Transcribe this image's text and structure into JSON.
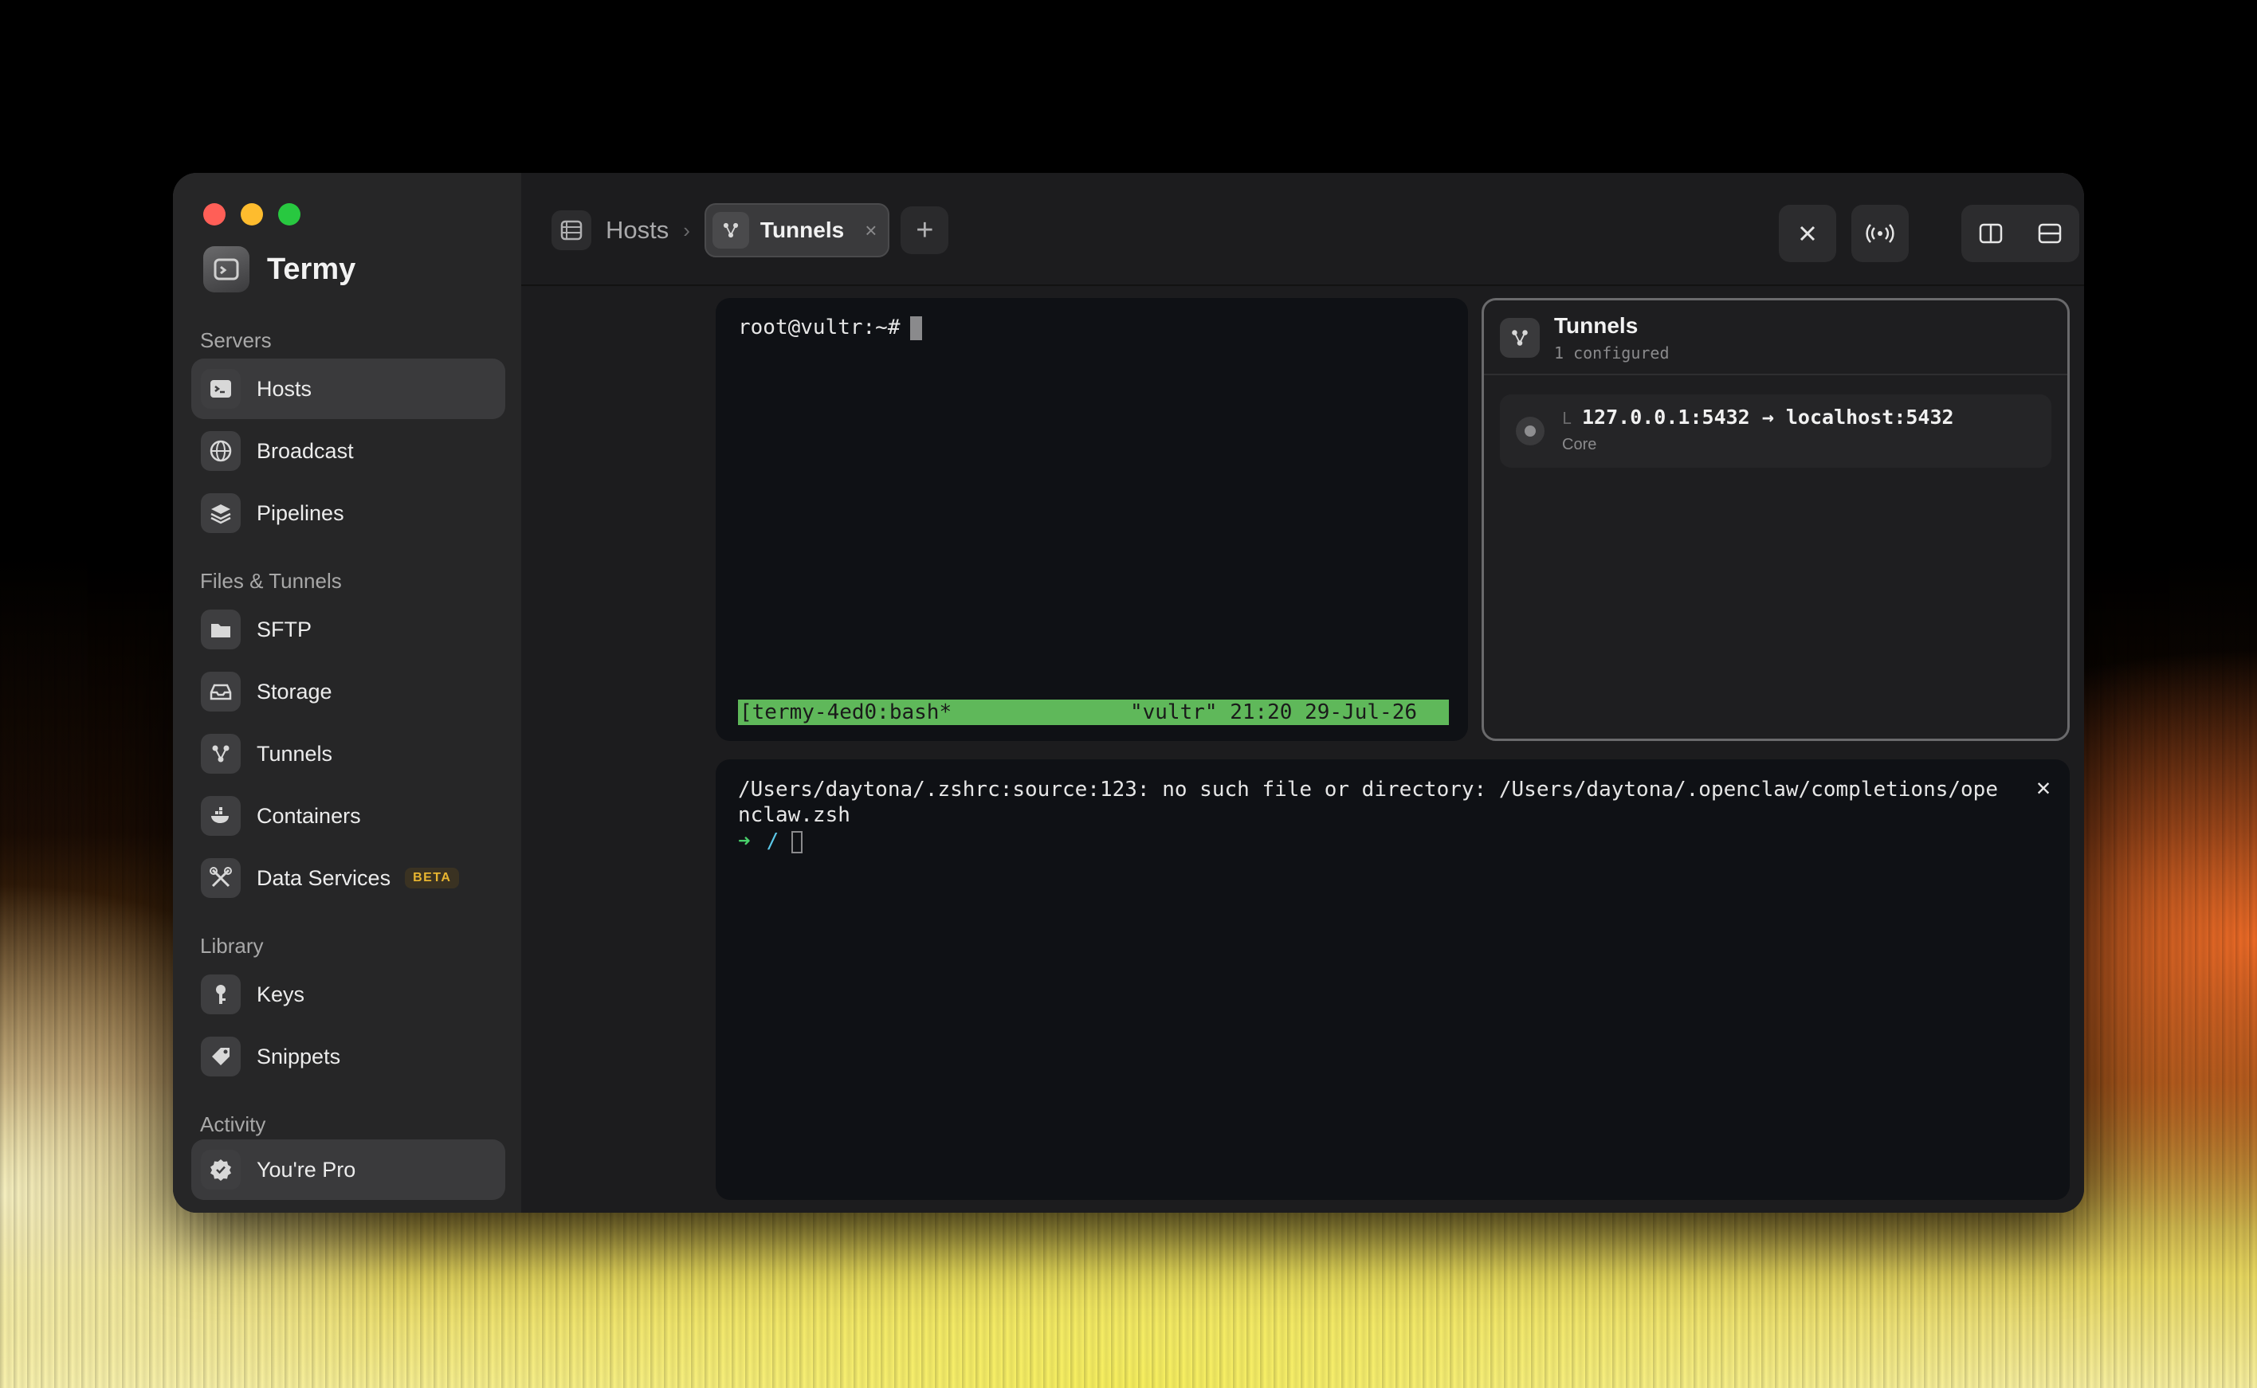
{
  "app": {
    "title": "Termy"
  },
  "sidebar": {
    "sections": [
      {
        "label": "Servers"
      },
      {
        "label": "Files & Tunnels"
      },
      {
        "label": "Library"
      },
      {
        "label": "Activity"
      }
    ],
    "items": [
      {
        "label": "Hosts",
        "icon": "terminal-icon"
      },
      {
        "label": "Broadcast",
        "icon": "globe-icon"
      },
      {
        "label": "Pipelines",
        "icon": "layers-icon"
      },
      {
        "label": "SFTP",
        "icon": "folder-icon"
      },
      {
        "label": "Storage",
        "icon": "tray-icon"
      },
      {
        "label": "Tunnels",
        "icon": "tunnel-nodes-icon"
      },
      {
        "label": "Containers",
        "icon": "whale-icon"
      },
      {
        "label": "Data Services",
        "icon": "tools-icon",
        "badge": "BETA"
      },
      {
        "label": "Keys",
        "icon": "key-icon"
      },
      {
        "label": "Snippets",
        "icon": "tag-icon"
      },
      {
        "label": "You're Pro",
        "icon": "verified-badge-icon"
      }
    ]
  },
  "topbar": {
    "breadcrumb": "Hosts",
    "tab": {
      "label": "Tunnels",
      "close": "×"
    },
    "add": "+"
  },
  "terminal1": {
    "prompt": "root@vultr:~#",
    "status_left": "[termy-4ed0:bash*",
    "status_right": "\"vultr\" 21:20 29-Jul-26"
  },
  "tunnels_panel": {
    "title": "Tunnels",
    "subtitle": "1 configured",
    "tunnels": [
      {
        "elbow": "L",
        "route": "127.0.0.1:5432 → localhost:5432",
        "group": "Core"
      }
    ]
  },
  "terminal2": {
    "error": "/Users/daytona/.zshrc:source:123: no such file or directory: /Users/daytona/.openclaw/completions/openclaw.zsh",
    "arrow": "➜",
    "path": "/",
    "close": "✕"
  },
  "colors": {
    "accent_green": "#5fb85a",
    "traffic_red": "#ff5f57",
    "traffic_yellow": "#febc2e",
    "traffic_green": "#28c840",
    "beta": "#e8b530"
  }
}
